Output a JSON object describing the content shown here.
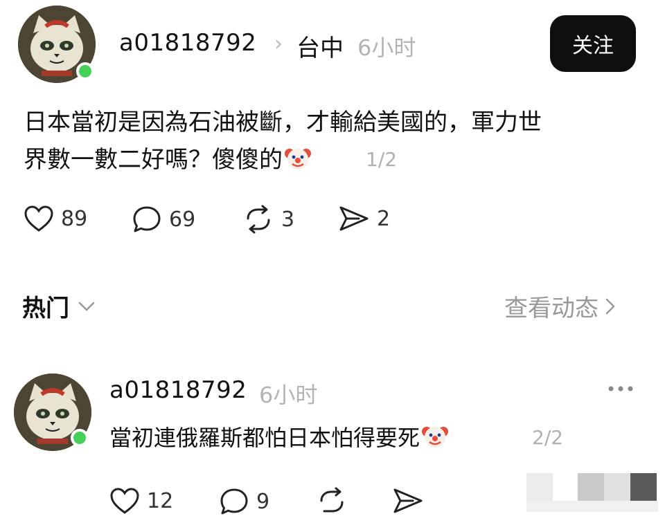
{
  "post": {
    "username": "a01818792",
    "location": "台中",
    "time": "6小时",
    "follow_label": "关注",
    "text_line1": "日本當初是因為石油被斷，才輸給美國的，軍力世",
    "text_line2": "界數一數二好嗎？傻傻的",
    "page_indicator": "1/2",
    "actions": {
      "likes": "89",
      "comments": "69",
      "reposts": "3",
      "shares": "2"
    }
  },
  "section": {
    "title": "热门",
    "view_more": "查看动态"
  },
  "comment": {
    "username": "a01818792",
    "time": "6小时",
    "text": "當初連俄羅斯都怕日本怕得要死",
    "page_indicator": "2/2",
    "actions": {
      "likes": "12",
      "comments": "9"
    }
  },
  "icons": {
    "avatar": "lucky-cat-avatar",
    "emoji": "clown-face-emoji",
    "like": "heart-icon",
    "comment": "comment-bubble-icon",
    "repost": "repost-icon",
    "share": "send-icon",
    "more": "more-dots-icon"
  },
  "colors": {
    "online": "#43d15a",
    "button_bg": "#0f0f0f",
    "muted_text": "#b4b4b4"
  }
}
